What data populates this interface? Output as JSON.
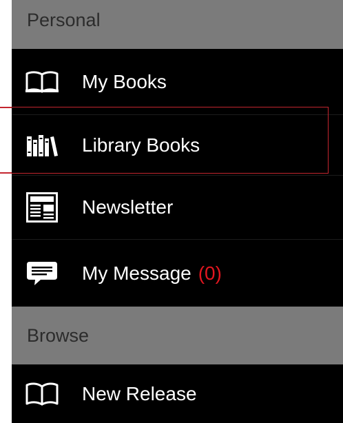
{
  "sections": {
    "personal": {
      "title": "Personal"
    },
    "browse": {
      "title": "Browse"
    }
  },
  "items": {
    "my_books": {
      "label": "My Books",
      "icon": "open-book-icon"
    },
    "library_books": {
      "label": "Library Books",
      "icon": "bookshelf-icon",
      "highlighted": true
    },
    "newsletter": {
      "label": "Newsletter",
      "icon": "newspaper-icon"
    },
    "my_message": {
      "label": "My Message",
      "count": "(0)",
      "icon": "chat-message-icon"
    },
    "new_release": {
      "label": "New Release",
      "icon": "open-book-icon"
    }
  },
  "colors": {
    "drawer_background": "#000000",
    "section_background": "#7b7b7b",
    "section_text": "#2c2c2c",
    "item_text": "#ffffff",
    "count_text": "#e1161f",
    "highlight_border": "#c4262f"
  }
}
